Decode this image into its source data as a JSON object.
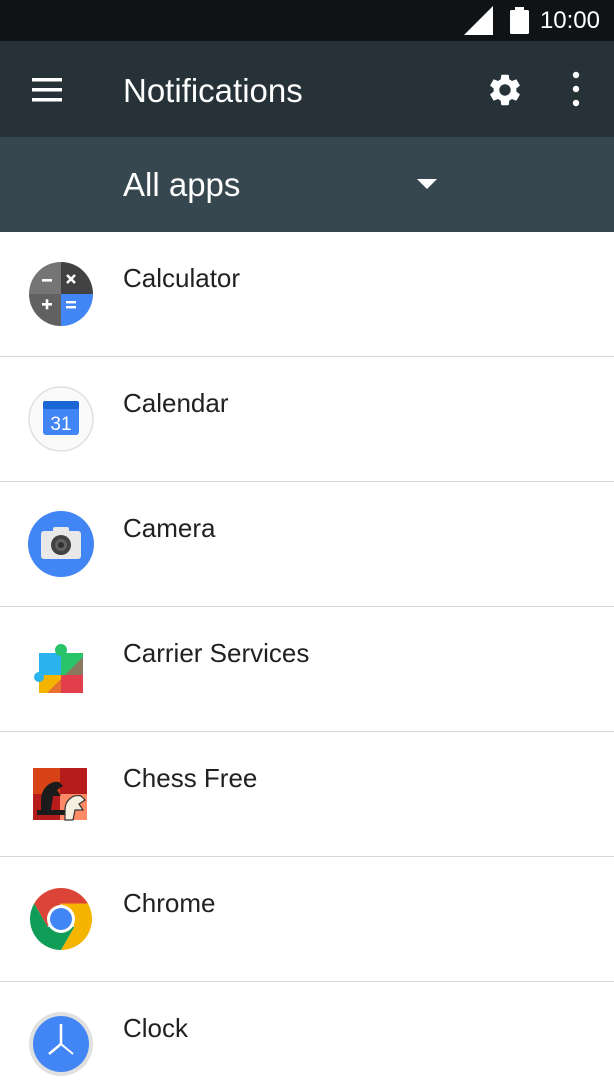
{
  "status_bar": {
    "time": "10:00"
  },
  "toolbar": {
    "title": "Notifications",
    "menu_icon": "hamburger-menu-icon",
    "settings_icon": "gear-icon",
    "overflow_icon": "overflow-menu-icon"
  },
  "filter": {
    "selected": "All apps",
    "icon": "dropdown-arrow-icon"
  },
  "apps": [
    {
      "name": "Calculator",
      "icon": "calculator-icon"
    },
    {
      "name": "Calendar",
      "icon": "calendar-icon",
      "icon_text": "31"
    },
    {
      "name": "Camera",
      "icon": "camera-icon"
    },
    {
      "name": "Carrier Services",
      "icon": "carrier-services-icon"
    },
    {
      "name": "Chess Free",
      "icon": "chess-free-icon"
    },
    {
      "name": "Chrome",
      "icon": "chrome-icon"
    },
    {
      "name": "Clock",
      "icon": "clock-icon"
    }
  ],
  "colors": {
    "status_bar": "#0f1316",
    "toolbar": "#263238",
    "filter_bar": "#37474f",
    "divider": "#d8d8d8",
    "text_primary": "#212121"
  }
}
